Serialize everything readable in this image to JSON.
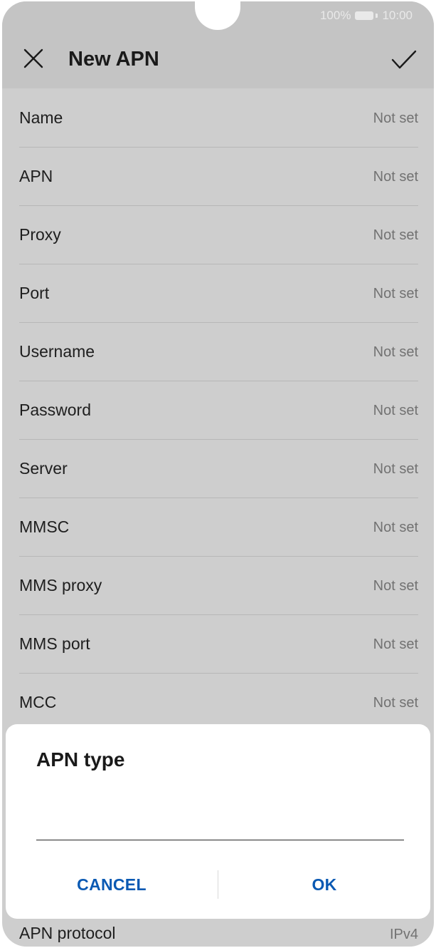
{
  "status_bar": {
    "battery": "100%",
    "time": "10:00"
  },
  "header": {
    "title": "New APN",
    "close_icon": "close-icon",
    "confirm_icon": "check-icon"
  },
  "fields": [
    {
      "label": "Name",
      "value": "Not set"
    },
    {
      "label": "APN",
      "value": "Not set"
    },
    {
      "label": "Proxy",
      "value": "Not set"
    },
    {
      "label": "Port",
      "value": "Not set"
    },
    {
      "label": "Username",
      "value": "Not set"
    },
    {
      "label": "Password",
      "value": "Not set"
    },
    {
      "label": "Server",
      "value": "Not set"
    },
    {
      "label": "MMSC",
      "value": "Not set"
    },
    {
      "label": "MMS proxy",
      "value": "Not set"
    },
    {
      "label": "MMS port",
      "value": "Not set"
    },
    {
      "label": "MCC",
      "value": "Not set"
    }
  ],
  "bottom_field": {
    "label": "APN protocol",
    "value": "IPv4"
  },
  "dialog": {
    "title": "APN type",
    "input_value": "",
    "cancel_label": "CANCEL",
    "ok_label": "OK"
  },
  "colors": {
    "accent": "#0a59b3",
    "scrim_background": "#cecece"
  }
}
